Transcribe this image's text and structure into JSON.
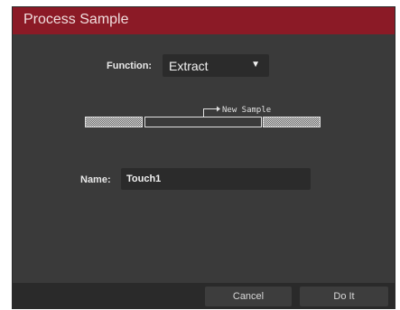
{
  "dialog": {
    "title": "Process Sample",
    "accent_color": "#8b1a26"
  },
  "function": {
    "label": "Function:",
    "selected": "Extract",
    "arrow_icon": "triangle-down-icon"
  },
  "diagram": {
    "new_sample_label": "New Sample"
  },
  "name": {
    "label": "Name:",
    "value": "Touch1"
  },
  "footer": {
    "cancel_label": "Cancel",
    "do_it_label": "Do It"
  }
}
